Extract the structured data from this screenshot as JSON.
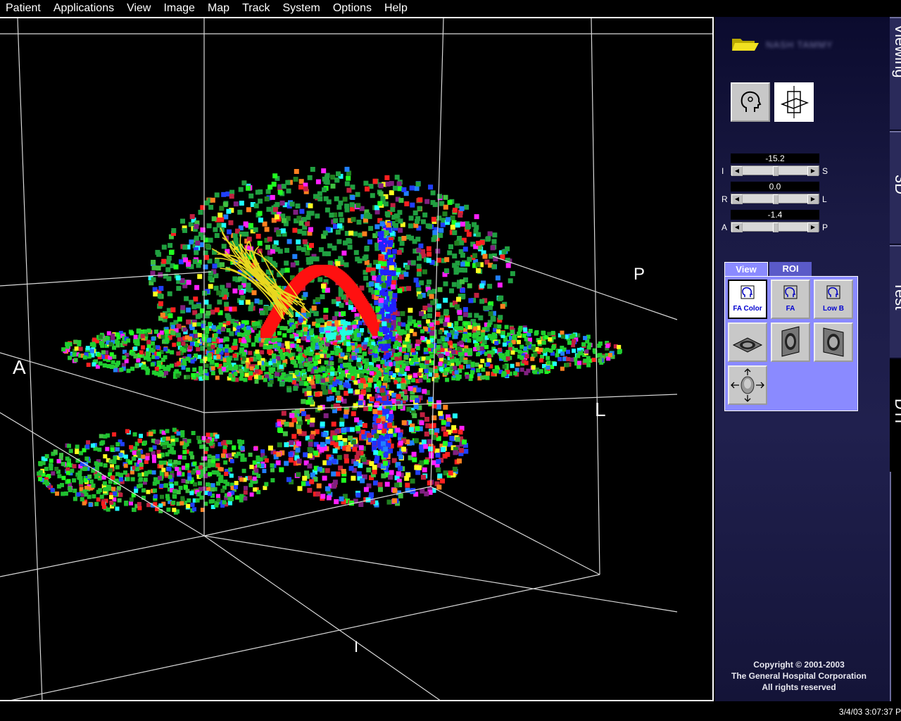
{
  "menu": [
    "Patient",
    "Applications",
    "View",
    "Image",
    "Map",
    "Track",
    "System",
    "Options",
    "Help"
  ],
  "viewport": {
    "labels": {
      "anterior": "A",
      "posterior": "P",
      "left": "L",
      "inferior": "I"
    }
  },
  "panel": {
    "patient_name": "NASH TAMMY",
    "sliders": [
      {
        "value": "-15.2",
        "left": "I",
        "right": "S",
        "position": 0.5
      },
      {
        "value": "0.0",
        "left": "R",
        "right": "L",
        "position": 0.5
      },
      {
        "value": "-1.4",
        "left": "A",
        "right": "P",
        "position": 0.5
      }
    ],
    "tabs": {
      "view": "View",
      "roi": "ROI"
    },
    "view_buttons": [
      "FA Color",
      "FA",
      "Low B"
    ],
    "copyright": [
      "Copyright © 2001-2003",
      "The General Hospital Corporation",
      "All rights reserved"
    ]
  },
  "side_tabs": [
    "Viewing",
    "3D",
    "Test",
    "DTI"
  ],
  "status": {
    "datetime": "3/4/03 3:07:37 P"
  },
  "colors": {
    "panel_accent": "#8a8aff",
    "tab_inactive": "#5a5ac8",
    "fiber": "#e8d820"
  }
}
